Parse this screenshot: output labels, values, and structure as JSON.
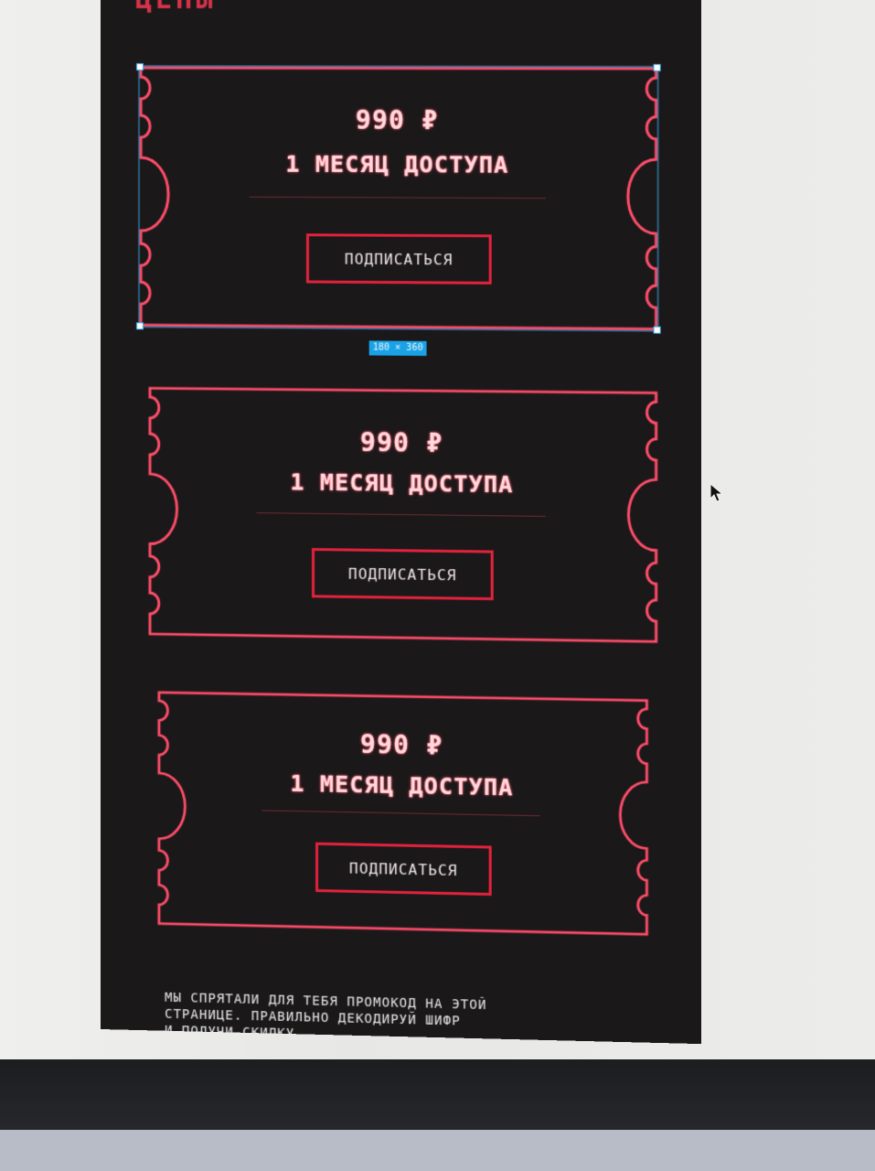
{
  "page": {
    "section_title": "ЦЕНЫ"
  },
  "selection": {
    "size_label": "180 × 360"
  },
  "cards": [
    {
      "price": "990 ₽",
      "period": "1 МЕСЯЦ ДОСТУПА",
      "button_label": "ПОДПИСАТЬСЯ"
    },
    {
      "price": "990 ₽",
      "period": "1 МЕСЯЦ ДОСТУПА",
      "button_label": "ПОДПИСАТЬСЯ"
    },
    {
      "price": "990 ₽",
      "period": "1 МЕСЯЦ ДОСТУПА",
      "button_label": "ПОДПИСАТЬСЯ"
    }
  ],
  "footer": {
    "promo_text": "МЫ СПРЯТАЛИ ДЛЯ ТЕБЯ ПРОМОКОД НА ЭТОЙ\nСТРАНИЦЕ. ПРАВИЛЬНО ДЕКОДИРУЙ ШИФР\nИ ПОЛУЧИ СКИДКУ"
  },
  "colors": {
    "panel_bg": "#1b1819",
    "ticket_outline": "#ff4d6a",
    "button_border": "#e2223c",
    "text_glow": "#ffd9dc",
    "selection": "#1aa2e6"
  }
}
